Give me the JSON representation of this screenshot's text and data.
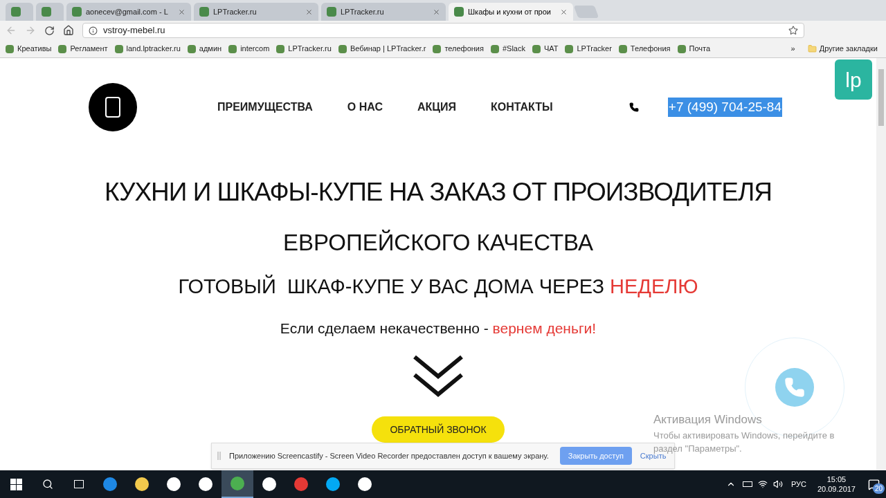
{
  "browser": {
    "tabs": [
      {
        "selected": false
      },
      {
        "selected": false
      },
      {
        "title": "aonecev@gmail.com - L",
        "selected": false
      },
      {
        "title": "LPTracker.ru",
        "selected": false
      },
      {
        "title": "LPTracker.ru",
        "selected": false
      },
      {
        "title": "Шкафы и кухни от прои",
        "selected": true
      }
    ],
    "url": "vstroy-mebel.ru",
    "bookmarks": [
      "Креативы",
      "Регламент",
      "land.lptracker.ru",
      "админ",
      "intercom",
      "LPTracker.ru",
      "Вебинар | LPTracker.r",
      "телефония",
      "#Slack",
      "ЧАТ",
      "LPTracker",
      "Телефония",
      "Почта"
    ],
    "more": "»",
    "other_bookmarks": "Другие закладки"
  },
  "page": {
    "nav": [
      "ПРЕИМУЩЕСТВА",
      "О НАС",
      "АКЦИЯ",
      "КОНТАКТЫ"
    ],
    "phone": "+7 (499) 704-25-84",
    "phone_selected": true,
    "headline": "КУХНИ И ШКАФЫ-КУПЕ НА ЗАКАЗ ОТ ПРОИЗВОДИТЕЛЯ",
    "subheadline": "ЕВРОПЕЙСКОГО КАЧЕСТВА",
    "offer": {
      "text": "ГОТОВЫЙ  ШКАФ-КУПЕ У ВАС ДОМА ЧЕРЕЗ",
      "accent": "НЕДЕЛЮ"
    },
    "guarantee": {
      "text": "Если сделаем некачественно -",
      "accent": "вернем деньги!"
    },
    "callback_button": "ОБРАТНЫЙ ЗВОНОК",
    "widget_label": "lp"
  },
  "share_bar": {
    "message": "Приложению Screencastify - Screen Video Recorder предоставлен доступ к вашему экрану.",
    "stop_button": "Закрыть доступ",
    "hide_link": "Скрыть"
  },
  "activation": {
    "title": "Активация Windows",
    "text": "Чтобы активировать Windows, перейдите в раздел \"Параметры\"."
  },
  "taskbar": {
    "apps": [
      {
        "kind": "edge",
        "active": false
      },
      {
        "kind": "folder",
        "active": false
      },
      {
        "kind": "store",
        "active": false
      },
      {
        "kind": "mail",
        "active": false
      },
      {
        "kind": "chrome",
        "active": true
      },
      {
        "kind": "yandex",
        "active": false
      },
      {
        "kind": "opera",
        "active": false
      },
      {
        "kind": "skype",
        "active": false
      },
      {
        "kind": "slack",
        "active": false
      }
    ],
    "language": "РУС",
    "time": "15:05",
    "date": "20.09.2017",
    "notifications": "20"
  }
}
